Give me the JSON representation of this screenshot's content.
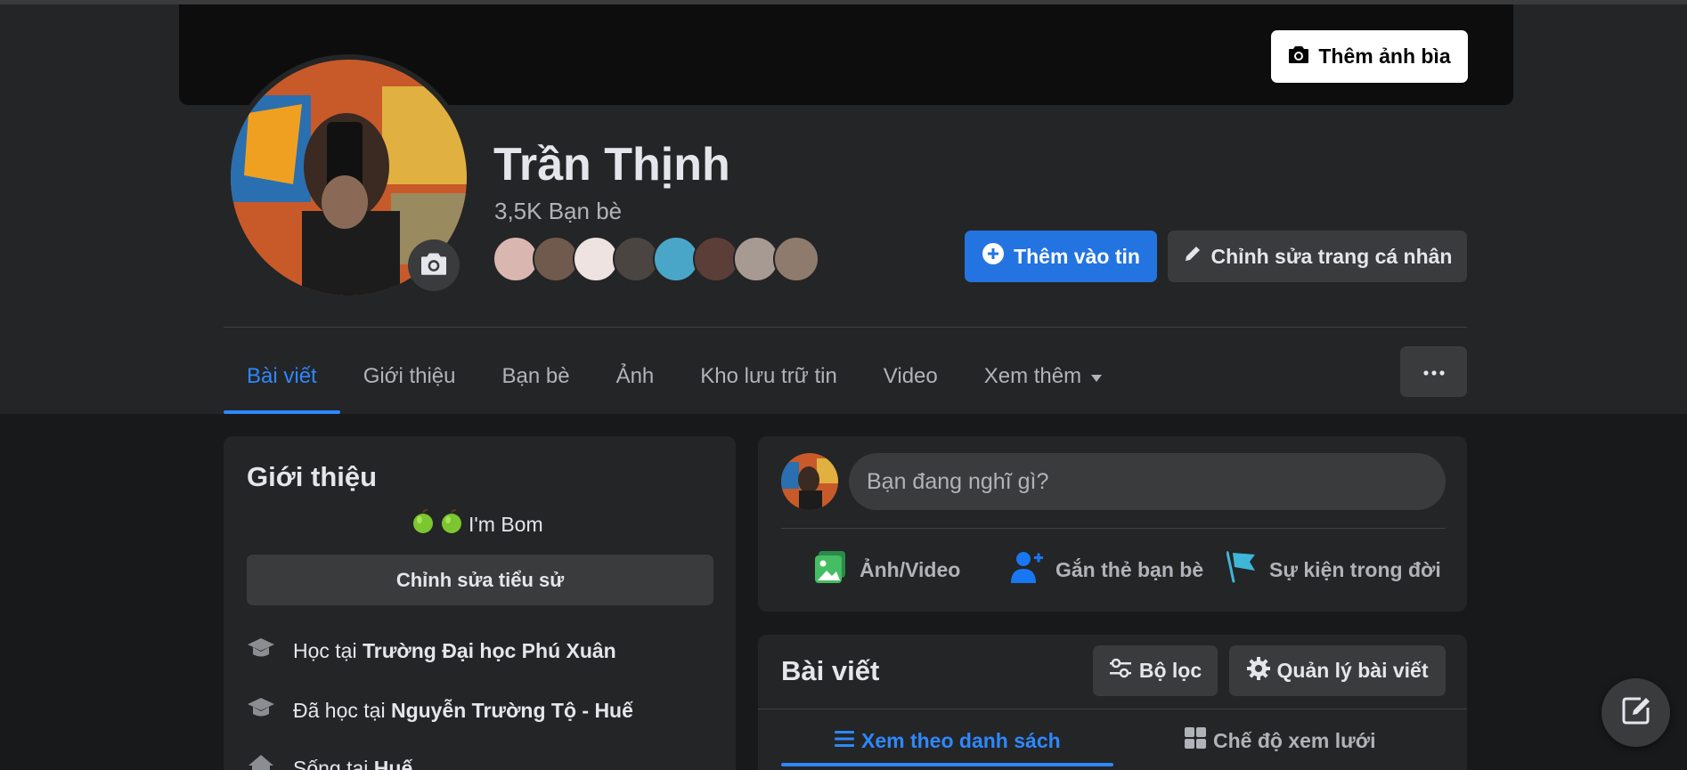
{
  "profile": {
    "name": "Trần Thịnh",
    "friends_count": "3,5K Bạn bè",
    "add_cover_label": "Thêm ảnh bìa",
    "add_story_label": "Thêm vào tin",
    "edit_profile_label": "Chỉnh sửa trang cá nhân"
  },
  "tabs": [
    {
      "label": "Bài viết",
      "active": true
    },
    {
      "label": "Giới thiệu"
    },
    {
      "label": "Bạn bè"
    },
    {
      "label": "Ảnh"
    },
    {
      "label": "Kho lưu trữ tin"
    },
    {
      "label": "Video"
    },
    {
      "label": "Xem thêm"
    }
  ],
  "intro": {
    "title": "Giới thiệu",
    "bio": "I'm Bom",
    "edit_bio_label": "Chỉnh sửa tiểu sử",
    "items": [
      {
        "prefix": "Học tại",
        "value": "Trường Đại học Phú Xuân",
        "icon": "graduation-cap-icon"
      },
      {
        "prefix": "Đã học tại",
        "value": "Nguyễn Trường Tộ - Huế",
        "icon": "graduation-cap-icon"
      },
      {
        "prefix": "Sống tại",
        "value": "Huế",
        "icon": "home-icon"
      }
    ]
  },
  "composer": {
    "placeholder": "Bạn đang nghĩ gì?",
    "actions": [
      {
        "label": "Ảnh/Video",
        "icon": "photo-video-icon"
      },
      {
        "label": "Gắn thẻ bạn bè",
        "icon": "tag-friends-icon"
      },
      {
        "label": "Sự kiện trong đời",
        "icon": "life-event-flag-icon"
      }
    ]
  },
  "posts": {
    "title": "Bài viết",
    "filter_label": "Bộ lọc",
    "manage_label": "Quản lý bài viết",
    "view_list_label": "Xem theo danh sách",
    "view_grid_label": "Chế độ xem lưới"
  },
  "colors": {
    "accent": "#2d88ff",
    "primary_button": "#2374e1",
    "card_bg": "#242526",
    "page_bg": "#18191a"
  }
}
